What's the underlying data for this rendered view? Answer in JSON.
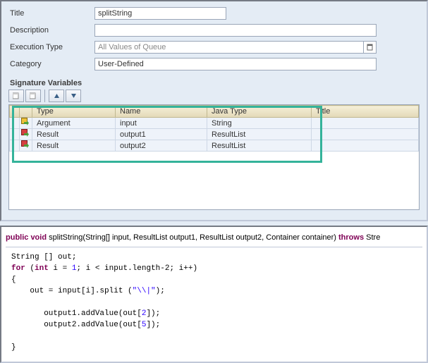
{
  "form": {
    "title_label": "Title",
    "title_value": "splitString",
    "desc_label": "Description",
    "desc_value": "",
    "exec_label": "Execution Type",
    "exec_value": "All Values of Queue",
    "cat_label": "Category",
    "cat_value": "User-Defined"
  },
  "section_title": "Signature Variables",
  "table": {
    "headers": {
      "type": "Type",
      "name": "Name",
      "java": "Java Type",
      "title": "Title"
    },
    "rows": [
      {
        "kind": "arg",
        "type": "Argument",
        "name": "input",
        "java": "String",
        "title": ""
      },
      {
        "kind": "res",
        "type": "Result",
        "name": "output1",
        "java": "ResultList",
        "title": ""
      },
      {
        "kind": "res",
        "type": "Result",
        "name": "output2",
        "java": "ResultList",
        "title": ""
      }
    ]
  },
  "signature": {
    "p1": "public void",
    "fn": " splitString(String[] input, ResultList output1, ResultList output2, Container container) ",
    "p2": "throws",
    "p3": " Stre"
  },
  "code": {
    "l1a": "String [] out;",
    "l2_kw1": "for",
    "l2_a": " (",
    "l2_kw2": "int",
    "l2_b": " i = ",
    "l2_n1": "1",
    "l2_c": "; i < input.length-2; i++)",
    "l3": "{",
    "l4a": "    out = input[i].split (",
    "l4s": "\"\\\\|\"",
    "l4b": ");",
    "l5a": "       output1.addValue(out[",
    "l5n": "2",
    "l5b": "]);",
    "l6a": "       output2.addValue(out[",
    "l6n": "5",
    "l6b": "]);",
    "l7": "}"
  }
}
